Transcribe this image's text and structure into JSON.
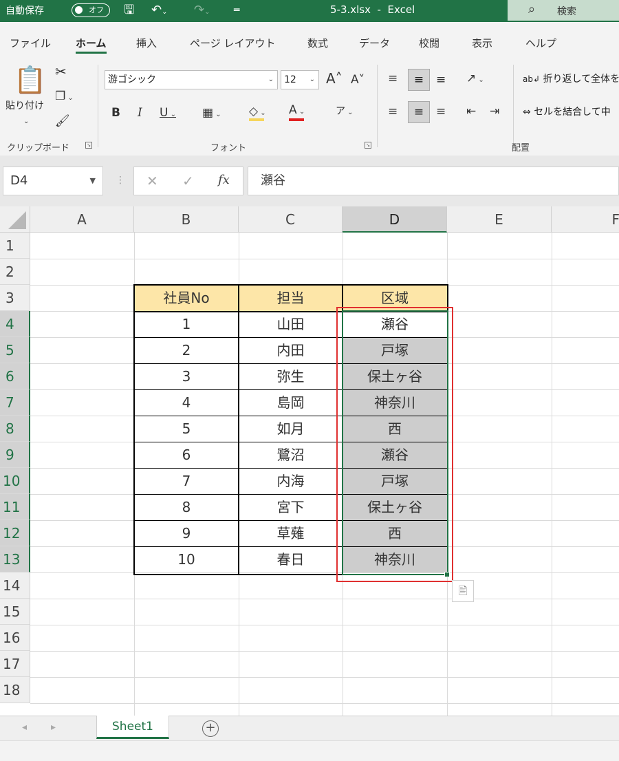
{
  "titlebar": {
    "autosave_label": "自動保存",
    "autosave_state": "オフ",
    "doc_title": "5-3.xlsx  -  Excel",
    "search_label": "検索"
  },
  "ribbon_tabs": [
    "ファイル",
    "ホーム",
    "挿入",
    "ページ レイアウト",
    "数式",
    "データ",
    "校閲",
    "表示",
    "ヘルプ"
  ],
  "ribbon": {
    "clipboard": {
      "paste_label": "貼り付け",
      "group_label": "クリップボード"
    },
    "font": {
      "font_name": "游ゴシック",
      "font_size": "12",
      "group_label": "フォント"
    },
    "alignment": {
      "wrap_text": "折り返して全体を",
      "merge_center": "セルを結合して中",
      "group_label": "配置"
    }
  },
  "formula_bar": {
    "name_box": "D4",
    "formula": "瀬谷",
    "fx": "fx"
  },
  "columns": [
    "A",
    "B",
    "C",
    "D",
    "E",
    "F"
  ],
  "rows": [
    "1",
    "2",
    "3",
    "4",
    "5",
    "6",
    "7",
    "8",
    "9",
    "10",
    "11",
    "12",
    "13",
    "14",
    "15",
    "16",
    "17",
    "18"
  ],
  "table": {
    "headers": [
      "社員No",
      "担当",
      "区域"
    ],
    "rows": [
      [
        "1",
        "山田",
        "瀬谷"
      ],
      [
        "2",
        "内田",
        "戸塚"
      ],
      [
        "3",
        "弥生",
        "保土ヶ谷"
      ],
      [
        "4",
        "島岡",
        "神奈川"
      ],
      [
        "5",
        "如月",
        "西"
      ],
      [
        "6",
        "鷺沼",
        "瀬谷"
      ],
      [
        "7",
        "内海",
        "戸塚"
      ],
      [
        "8",
        "宮下",
        "保土ヶ谷"
      ],
      [
        "9",
        "草薙",
        "西"
      ],
      [
        "10",
        "春日",
        "神奈川"
      ]
    ]
  },
  "sheet_tabs": [
    "Sheet1"
  ],
  "colors": {
    "excel_green": "#217346",
    "header_fill": "#fde6a8",
    "selection_fill": "#cdcdcd",
    "annotation_red": "#e03030"
  }
}
